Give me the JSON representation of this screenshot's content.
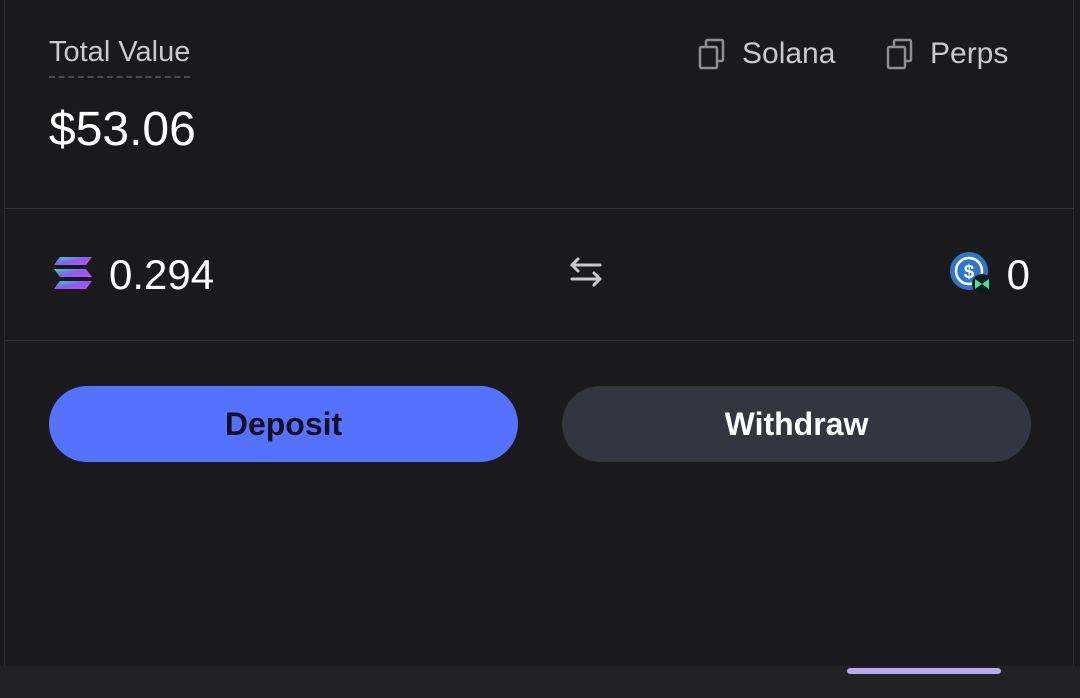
{
  "header": {
    "total_label": "Total Value",
    "total_amount": "$53.06",
    "links": [
      {
        "label": "Solana",
        "icon": "copy-icon"
      },
      {
        "label": "Perps",
        "icon": "copy-icon"
      }
    ]
  },
  "balances": {
    "sol": {
      "icon": "solana-logo-icon",
      "value": "0.294"
    },
    "swap_icon": "swap-arrows-icon",
    "usdc": {
      "icon": "usdc-logo-icon",
      "value": "0"
    }
  },
  "actions": {
    "deposit_label": "Deposit",
    "withdraw_label": "Withdraw"
  },
  "colors": {
    "background": "#1a1a1c",
    "deposit_button": "#5472ff",
    "withdraw_button": "#333540",
    "home_indicator": "#b7a8f0"
  }
}
